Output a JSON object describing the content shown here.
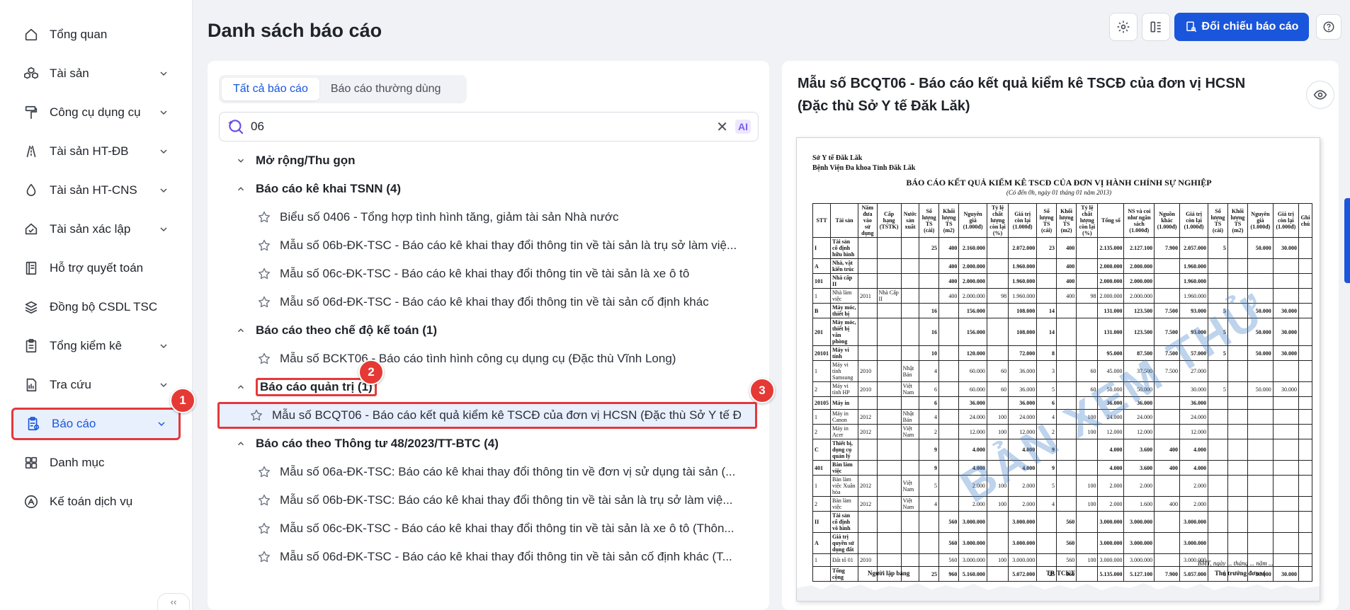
{
  "sidebar": {
    "items": [
      {
        "label": "Tổng quan",
        "icon": "home-icon",
        "has_chevron": false
      },
      {
        "label": "Tài sản",
        "icon": "cubes-icon",
        "has_chevron": true
      },
      {
        "label": "Công cụ dụng cụ",
        "icon": "paint-roller-icon",
        "has_chevron": true
      },
      {
        "label": "Tài sản HT-ĐB",
        "icon": "road-icon",
        "has_chevron": true
      },
      {
        "label": "Tài sản HT-CNS",
        "icon": "water-drop-icon",
        "has_chevron": true
      },
      {
        "label": "Tài sản xác lập",
        "icon": "home-check-icon",
        "has_chevron": true
      },
      {
        "label": "Hỗ trợ quyết toán",
        "icon": "ledger-icon",
        "has_chevron": false
      },
      {
        "label": "Đồng bộ CSDL TSC",
        "icon": "layers-sync-icon",
        "has_chevron": false
      },
      {
        "label": "Tổng kiểm kê",
        "icon": "clipboard-icon",
        "has_chevron": true
      },
      {
        "label": "Tra cứu",
        "icon": "chart-search-icon",
        "has_chevron": true
      },
      {
        "label": "Báo cáo",
        "icon": "report-icon",
        "has_chevron": true,
        "active": true
      },
      {
        "label": "Danh mục",
        "icon": "grid-icon",
        "has_chevron": false
      },
      {
        "label": "Kế toán dịch vụ",
        "icon": "accounting-icon",
        "has_chevron": false
      }
    ]
  },
  "badges": {
    "one": "1",
    "two": "2",
    "three": "3"
  },
  "header": {
    "title": "Danh sách báo cáo",
    "compare_button": "Đối chiếu báo cáo"
  },
  "left": {
    "tabs": [
      "Tất cả báo cáo",
      "Báo cáo thường dùng"
    ],
    "search": {
      "value": "06",
      "ai_label": "AI"
    },
    "tree": {
      "toggle": "Mở rộng/Thu gọn",
      "groups": [
        {
          "title": "Báo cáo kê khai TSNN (4)",
          "items": [
            "Biểu số 0406 - Tổng hợp tình hình tăng, giảm tài sản Nhà nước",
            "Mẫu số 06b-ĐK-TSC - Báo cáo kê khai thay đổi thông tin về tài sản là trụ sở làm việ...",
            "Mẫu số 06c-ĐK-TSC - Báo cáo kê khai thay đổi thông tin về tài sản là xe ô tô",
            "Mẫu số 06d-ĐK-TSC - Báo cáo kê khai thay đổi thông tin về tài sản cố định khác"
          ]
        },
        {
          "title": "Báo cáo theo chế độ kế toán (1)",
          "items": [
            "Mẫu số BCKT06 - Báo cáo tình hình công cụ dụng cụ (Đặc thù Vĩnh Long)"
          ]
        },
        {
          "title": "Báo cáo quản trị (1)",
          "items": [
            "Mẫu số BCQT06 - Báo cáo kết quả kiểm kê TSCĐ của đơn vị HCSN (Đặc thù Sở Y tế Đ"
          ]
        },
        {
          "title": "Báo cáo theo Thông tư 48/2023/TT-BTC (4)",
          "items": [
            "Mẫu số 06a-ĐK-TSC: Báo cáo kê khai thay đổi thông tin về đơn vị sử dụng tài sản (...",
            "Mẫu số 06b-ĐK-TSC: Báo cáo kê khai thay đổi thông tin về tài sản là trụ sở làm việ...",
            "Mẫu số 06c-ĐK-TSC - Báo cáo kê khai thay đổi thông tin về tài sản là xe ô tô (Thôn...",
            "Mẫu số 06d-ĐK-TSC - Báo cáo kê khai thay đổi thông tin về tài sản cố định khác (T..."
          ]
        }
      ]
    }
  },
  "right": {
    "title": "Mẫu số BCQT06 - Báo cáo kết quả kiểm kê TSCĐ của đơn vị HCSN (Đặc thù Sở Y tế Đăk Lăk)",
    "doc": {
      "org1": "Sở Y tế Đăk Lăk",
      "org2": "Bệnh Viện Đa khoa Tỉnh Đăk Lăk",
      "title": "BÁO CÁO KẾT QUẢ KIỂM KÊ TSCĐ CỦA ĐƠN VỊ HÀNH CHÍNH SỰ NGHIỆP",
      "subtitle": "(Có đến 0h, ngày 01 tháng 01 năm 2013)",
      "watermark": "BẢN XEM THỬ",
      "headers": [
        "STT",
        "Tài sản",
        "Năm đưa vào sử dụng",
        "Cấp hạng (TSTK)",
        "Nước sản xuất",
        "Số lượng TS (cái)",
        "Khối lượng TS (m2)",
        "Nguyên giá (1.000đ)",
        "Tỷ lệ chất lượng còn lại (%)",
        "Giá trị còn lại (1.000đ)",
        "Số lượng TS (cái)",
        "Khối lượng TS (m2)",
        "Tỷ lệ chất lượng còn lại (%)",
        "Tổng số",
        "NS và coi như ngân sách (1.000đ)",
        "Nguồn khác (1.000đ)",
        "Giá trị còn lại (1.000đ)",
        "Số lượng TS (cái)",
        "Khối lượng TS (m2)",
        "Nguyên giá (1.000đ)",
        "Giá trị còn lại (1.000đ)",
        "Ghi chú"
      ],
      "rows": [
        {
          "b": true,
          "c": [
            "I",
            "Tài sản cố định hữu hình",
            "",
            "",
            "",
            "25",
            "400",
            "2.160.000",
            "",
            "2.072.000",
            "23",
            "400",
            "",
            "2.135.000",
            "2.127.100",
            "7.900",
            "2.057.000",
            "5",
            "",
            "50.000",
            "30.000",
            ""
          ]
        },
        {
          "b": true,
          "c": [
            "A",
            "Nhà, vật kiến trúc",
            "",
            "",
            "",
            "",
            "400",
            "2.000.000",
            "",
            "1.960.000",
            "",
            "400",
            "",
            "2.000.000",
            "2.000.000",
            "",
            "1.960.000",
            "",
            "",
            "",
            "",
            ""
          ]
        },
        {
          "b": true,
          "c": [
            "101",
            "Nhà cấp II",
            "",
            "",
            "",
            "",
            "400",
            "2.000.000",
            "",
            "1.960.000",
            "",
            "400",
            "",
            "2.000.000",
            "2.000.000",
            "",
            "1.960.000",
            "",
            "",
            "",
            "",
            ""
          ]
        },
        {
          "b": false,
          "c": [
            "1",
            "Nhà làm việc",
            "2011",
            "Nhà Cấp II",
            "",
            "",
            "400",
            "2.000.000",
            "98",
            "1.960.000",
            "",
            "400",
            "98",
            "2.000.000",
            "2.000.000",
            "",
            "1.960.000",
            "",
            "",
            "",
            "",
            ""
          ]
        },
        {
          "b": true,
          "c": [
            "B",
            "Máy móc, thiết bị",
            "",
            "",
            "",
            "16",
            "",
            "156.000",
            "",
            "108.000",
            "14",
            "",
            "",
            "131.000",
            "123.500",
            "7.500",
            "93.000",
            "5",
            "",
            "50.000",
            "30.000",
            ""
          ]
        },
        {
          "b": true,
          "c": [
            "201",
            "Máy móc, thiết bị văn phòng",
            "",
            "",
            "",
            "16",
            "",
            "156.000",
            "",
            "108.000",
            "14",
            "",
            "",
            "131.000",
            "123.500",
            "7.500",
            "93.000",
            "5",
            "",
            "50.000",
            "30.000",
            ""
          ]
        },
        {
          "b": true,
          "c": [
            "20101",
            "Máy vi tính",
            "",
            "",
            "",
            "10",
            "",
            "120.000",
            "",
            "72.000",
            "8",
            "",
            "",
            "95.000",
            "87.500",
            "7.500",
            "57.000",
            "5",
            "",
            "50.000",
            "30.000",
            ""
          ]
        },
        {
          "b": false,
          "c": [
            "1",
            "Máy vi tính Samsung",
            "2010",
            "",
            "Nhật Bản",
            "4",
            "",
            "60.000",
            "60",
            "36.000",
            "3",
            "",
            "60",
            "45.000",
            "37.500",
            "7.500",
            "27.000",
            "",
            "",
            "",
            "",
            ""
          ]
        },
        {
          "b": false,
          "c": [
            "2",
            "Máy vi tính HP",
            "2010",
            "",
            "Việt Nam",
            "6",
            "",
            "60.000",
            "60",
            "36.000",
            "5",
            "",
            "60",
            "50.000",
            "50.000",
            "",
            "30.000",
            "5",
            "",
            "50.000",
            "30.000",
            ""
          ]
        },
        {
          "b": true,
          "c": [
            "20105",
            "Máy in",
            "",
            "",
            "",
            "6",
            "",
            "36.000",
            "",
            "36.000",
            "6",
            "",
            "",
            "36.000",
            "36.000",
            "",
            "36.000",
            "",
            "",
            "",
            "",
            ""
          ]
        },
        {
          "b": false,
          "c": [
            "1",
            "Máy in Canon",
            "2012",
            "",
            "Nhật Bản",
            "4",
            "",
            "24.000",
            "100",
            "24.000",
            "4",
            "",
            "100",
            "24.000",
            "24.000",
            "",
            "24.000",
            "",
            "",
            "",
            "",
            ""
          ]
        },
        {
          "b": false,
          "c": [
            "2",
            "Máy in Acer",
            "2012",
            "",
            "Việt Nam",
            "2",
            "",
            "12.000",
            "100",
            "12.000",
            "2",
            "",
            "100",
            "12.000",
            "12.000",
            "",
            "12.000",
            "",
            "",
            "",
            "",
            ""
          ]
        },
        {
          "b": true,
          "c": [
            "C",
            "Thiết bị, dụng cụ quản lý",
            "",
            "",
            "",
            "9",
            "",
            "4.000",
            "",
            "4.000",
            "9",
            "",
            "",
            "4.000",
            "3.600",
            "400",
            "4.000",
            "",
            "",
            "",
            "",
            ""
          ]
        },
        {
          "b": true,
          "c": [
            "401",
            "Bàn làm việc",
            "",
            "",
            "",
            "9",
            "",
            "4.000",
            "",
            "4.000",
            "9",
            "",
            "",
            "4.000",
            "3.600",
            "400",
            "4.000",
            "",
            "",
            "",
            "",
            ""
          ]
        },
        {
          "b": false,
          "c": [
            "1",
            "Bàn làm việc Xuân hòa",
            "2012",
            "",
            "Việt Nam",
            "5",
            "",
            "2.000",
            "100",
            "2.000",
            "5",
            "",
            "100",
            "2.000",
            "2.000",
            "",
            "2.000",
            "",
            "",
            "",
            "",
            ""
          ]
        },
        {
          "b": false,
          "c": [
            "2",
            "Bàn làm việc",
            "2012",
            "",
            "Việt Nam",
            "4",
            "",
            "2.000",
            "100",
            "2.000",
            "4",
            "",
            "100",
            "2.000",
            "1.600",
            "400",
            "2.000",
            "",
            "",
            "",
            "",
            ""
          ]
        },
        {
          "b": true,
          "c": [
            "II",
            "Tài sản cố định vô hình",
            "",
            "",
            "",
            "",
            "560",
            "3.000.000",
            "",
            "3.000.000",
            "",
            "560",
            "",
            "3.000.000",
            "3.000.000",
            "",
            "3.000.000",
            "",
            "",
            "",
            "",
            ""
          ]
        },
        {
          "b": true,
          "c": [
            "A",
            "Giá trị quyền sử dụng đất",
            "",
            "",
            "",
            "",
            "560",
            "3.000.000",
            "",
            "3.000.000",
            "",
            "560",
            "",
            "3.000.000",
            "3.000.000",
            "",
            "3.000.000",
            "",
            "",
            "",
            "",
            ""
          ]
        },
        {
          "b": false,
          "c": [
            "1",
            "Đất tổ 01",
            "2010",
            "",
            "",
            "",
            "560",
            "3.000.000",
            "100",
            "3.000.000",
            "",
            "560",
            "100",
            "3.000.000",
            "3.000.000",
            "",
            "3.000.000",
            "",
            "",
            "",
            "",
            ""
          ]
        },
        {
          "b": true,
          "c": [
            "",
            "Tổng cộng",
            "",
            "",
            "",
            "25",
            "960",
            "5.160.000",
            "",
            "5.072.000",
            "23",
            "960",
            "",
            "5.135.000",
            "5.127.100",
            "7.900",
            "5.057.000",
            "5",
            "",
            "50.000",
            "30.000",
            ""
          ]
        }
      ],
      "sign1": "Người lập bảng",
      "sign2": "TP. TCKT",
      "sign3": "Thủ trưởng đơn vị",
      "sign_date": "BMT, ngày ... tháng ... năm ..."
    }
  }
}
